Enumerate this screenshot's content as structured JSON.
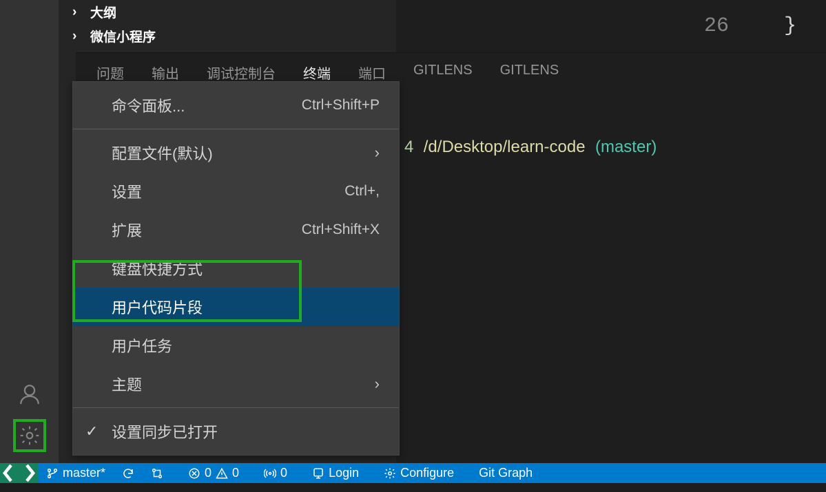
{
  "sidebar": {
    "sections": [
      {
        "chevron": "›",
        "label": "大纲"
      },
      {
        "chevron": "›",
        "label": "微信小程序"
      }
    ]
  },
  "panel": {
    "tabs": [
      {
        "label": "问题",
        "active": false
      },
      {
        "label": "输出",
        "active": false
      },
      {
        "label": "调试控制台",
        "active": false
      },
      {
        "label": "终端",
        "active": true
      },
      {
        "label": "端口",
        "active": false
      },
      {
        "label": "GITLENS",
        "active": false
      },
      {
        "label": "GITLENS",
        "active": false
      }
    ]
  },
  "editor": {
    "line_number": "26",
    "brace": "}"
  },
  "terminal": {
    "seg1": "4",
    "seg2": "/d/Desktop/learn-code",
    "seg3_open": "(",
    "seg3_branch": "master",
    "seg3_close": ")"
  },
  "menu": {
    "items": [
      {
        "label": "命令面板...",
        "shortcut": "Ctrl+Shift+P",
        "type": "cmd"
      },
      {
        "type": "sep"
      },
      {
        "label": "配置文件(默认)",
        "submenu": true,
        "type": "cmd"
      },
      {
        "label": "设置",
        "shortcut": "Ctrl+,",
        "type": "cmd"
      },
      {
        "label": "扩展",
        "shortcut": "Ctrl+Shift+X",
        "type": "cmd"
      },
      {
        "label": "键盘快捷方式",
        "type": "cmd"
      },
      {
        "label": "用户代码片段",
        "type": "cmd",
        "hovered": true
      },
      {
        "label": "用户任务",
        "type": "cmd"
      },
      {
        "label": "主题",
        "submenu": true,
        "type": "cmd"
      },
      {
        "type": "sep"
      },
      {
        "label": "设置同步已打开",
        "checked": true,
        "type": "cmd"
      }
    ]
  },
  "statusbar": {
    "branch": "master*",
    "errors": "0",
    "warnings": "0",
    "ports": "0",
    "login": "Login",
    "configure": "Configure",
    "gitgraph": "Git Graph"
  },
  "icons": {
    "account": "account-icon",
    "gear": "gear-icon"
  }
}
